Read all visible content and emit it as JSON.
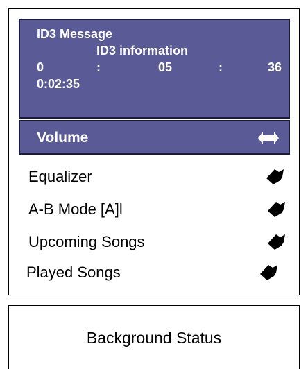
{
  "id3_panel": {
    "title": "ID3 Message",
    "info": "ID3 information",
    "time": {
      "hours": "0",
      "sep1": ":",
      "minutes": "05",
      "sep2": ":",
      "seconds": "36"
    },
    "elapsed": "0:02:35"
  },
  "volume": {
    "label": "Volume",
    "icon": "dual-arrow-icon"
  },
  "menu": {
    "items": [
      {
        "label": "Equalizer",
        "icon": "arrow-icon"
      },
      {
        "label": "A-B Mode [A]l",
        "icon": "arrow-icon"
      },
      {
        "label": "Upcoming Songs",
        "icon": "arrow-icon"
      },
      {
        "label": "Played Songs",
        "icon": "arrow-icon"
      }
    ]
  },
  "status": {
    "text": "Background Status"
  },
  "colors": {
    "panel_bg": "#5a5a96",
    "panel_border": "#1a1a40",
    "panel_text": "#ffffff",
    "arrow": "#000000"
  }
}
